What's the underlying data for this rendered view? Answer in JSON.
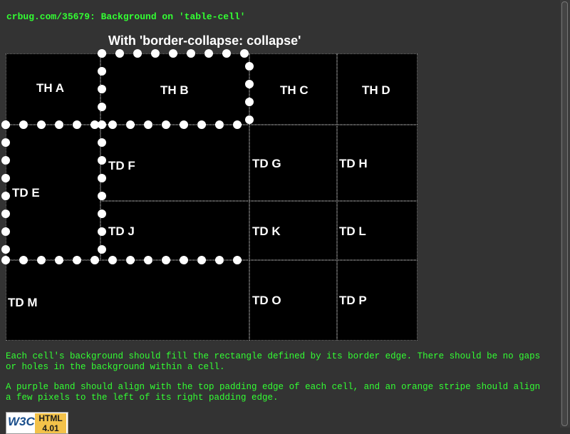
{
  "heading": "crbug.com/35679: Background on 'table-cell'",
  "caption": "With 'border-collapse: collapse'",
  "cells": {
    "th_a": "TH A",
    "th_b": "TH B",
    "th_c": "TH C",
    "th_d": "TH D",
    "td_e": "TD E",
    "td_f": "TD F",
    "td_g": "TD G",
    "td_h": "TD H",
    "td_j": "TD J",
    "td_k": "TD K",
    "td_l": "TD L",
    "td_m": "TD M",
    "td_o": "TD O",
    "td_p": "TD P"
  },
  "paragraph_1": "Each cell's background should fill the rectangle defined by its border edge. There should be no gaps or holes in the background within a cell.",
  "paragraph_2": "A purple band should align with the top padding edge of each cell, and an orange stripe should align a few pixels to the left of its right padding edge.",
  "badge": {
    "left_text": "W3C",
    "right_text": "HTML 4.01"
  },
  "colors": {
    "text_green": "#33ff33",
    "page_bg": "#333333",
    "cell_bg": "#000000",
    "dots": "#ffffff"
  }
}
